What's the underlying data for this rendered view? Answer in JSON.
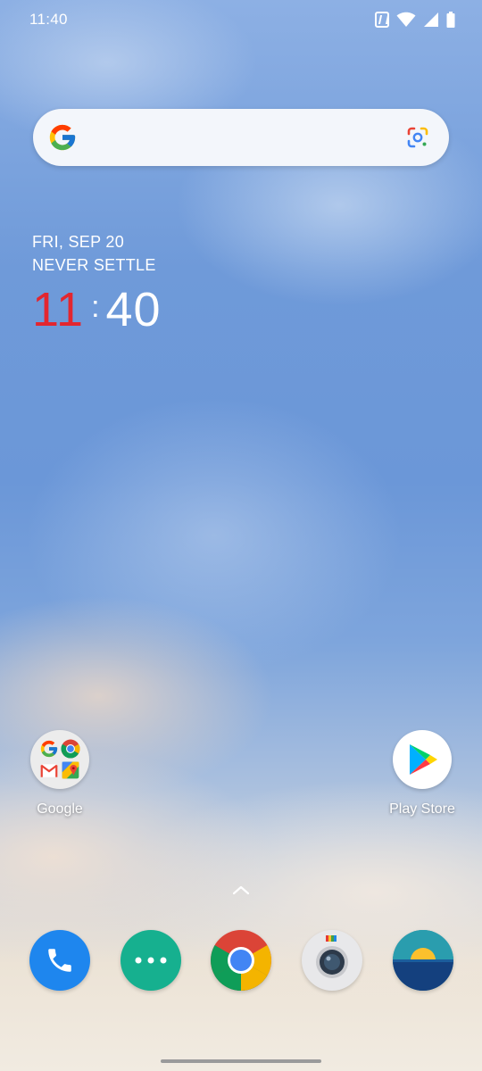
{
  "status_bar": {
    "time": "11:40",
    "icons": [
      "nfc-icon",
      "wifi-icon",
      "signal-icon",
      "battery-icon"
    ]
  },
  "search": {
    "placeholder": "",
    "icons": [
      "google-g-icon",
      "google-lens-icon"
    ]
  },
  "date_widget": {
    "date": "FRI, SEP 20",
    "slogan": "NEVER SETTLE",
    "clock": {
      "hour": "11",
      "separator": ":",
      "minute": "40"
    },
    "hour_color": "#e3262f"
  },
  "home_apps": [
    {
      "label": "Google",
      "icon": "google-folder-icon"
    },
    {
      "label": "Play Store",
      "icon": "play-store-icon"
    }
  ],
  "dock": [
    {
      "icon": "phone-icon",
      "color": "#1e86ee"
    },
    {
      "icon": "messages-icon",
      "color": "#16b08f"
    },
    {
      "icon": "chrome-icon"
    },
    {
      "icon": "camera-icon",
      "color": "#e8e8ea"
    },
    {
      "icon": "weather-icon",
      "color": "#2a8fa0"
    }
  ]
}
